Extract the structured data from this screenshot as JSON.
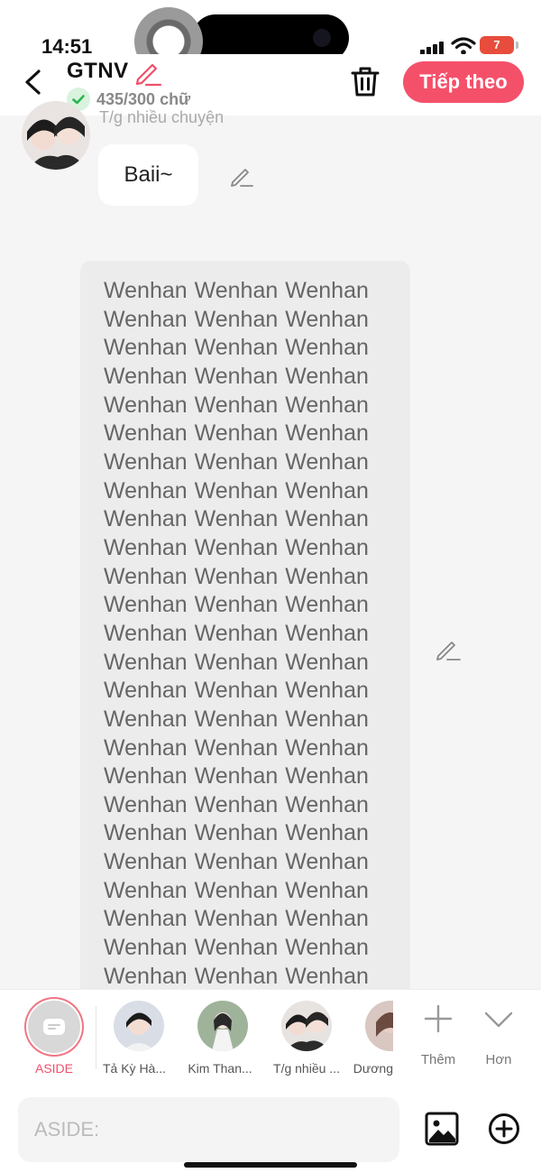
{
  "status": {
    "time": "14:51",
    "battery": "7"
  },
  "header": {
    "title": "GTNV",
    "word_count": "435/300 chữ",
    "next_label": "Tiếp theo"
  },
  "chat": {
    "previous_speaker": "T/g nhiều chuyện",
    "short_message": "Baii~",
    "long_message": "Wenhan Wenhan Wenhan Wenhan Wenhan Wenhan Wenhan Wenhan Wenhan Wenhan Wenhan Wenhan Wenhan Wenhan Wenhan Wenhan Wenhan Wenhan Wenhan Wenhan Wenhan Wenhan Wenhan Wenhan Wenhan Wenhan Wenhan Wenhan Wenhan Wenhan Wenhan Wenhan Wenhan Wenhan Wenhan Wenhan Wenhan Wenhan Wenhan Wenhan Wenhan Wenhan Wenhan Wenhan Wenhan Wenhan Wenhan Wenhan Wenhan Wenhan Wenhan Wenhan Wenhan Wenhan Wenhan Wenhan Wenhan Wenhan Wenhan Wenhan Wenhan Wenhan Wenhan Wenhan Wenhan Wenhan Wenhan Wenhan Wenhan Wenhan Wenhan Wenhan Wenhan Wenhan Wenhan"
  },
  "characters": {
    "aside_label": "ASIDE",
    "items": [
      {
        "name": "Tả Kỳ Hà..."
      },
      {
        "name": "Kim Than..."
      },
      {
        "name": "T/g nhiều ..."
      },
      {
        "name": "Dương"
      }
    ],
    "add_label": "Thêm",
    "more_label": "Hơn"
  },
  "input": {
    "placeholder": "ASIDE:"
  },
  "colors": {
    "accent": "#f5506a",
    "bubble": "#ececec",
    "background": "#f5f5f5"
  }
}
